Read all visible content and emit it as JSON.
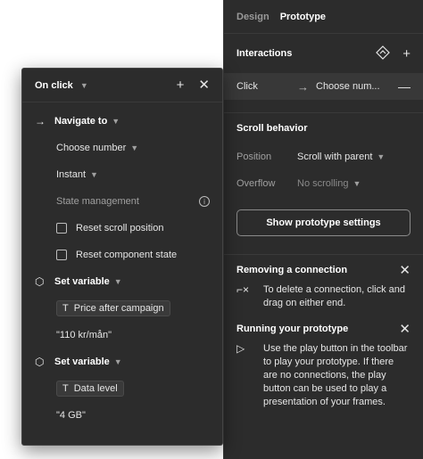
{
  "right_panel": {
    "tabs": [
      "Design",
      "Prototype"
    ],
    "interactions": {
      "title": "Interactions",
      "row": {
        "trigger": "Click",
        "destination": "Choose num..."
      }
    },
    "scroll_behavior": {
      "title": "Scroll behavior",
      "position_label": "Position",
      "position_value": "Scroll with parent",
      "overflow_label": "Overflow",
      "overflow_value": "No scrolling"
    },
    "settings_button": "Show prototype settings",
    "help": [
      {
        "title": "Removing a connection",
        "text": "To delete a connection, click and drag on either end."
      },
      {
        "title": "Running your prototype",
        "text": "Use the play button in the toolbar to play your prototype. If there are no connections, the play button can be used to play a presentation of your frames."
      }
    ]
  },
  "popover": {
    "title": "On click",
    "navigate_label": "Navigate to",
    "destination": "Choose number",
    "animation": "Instant",
    "state_management": "State management",
    "reset_scroll": "Reset scroll position",
    "reset_component": "Reset component state",
    "set_variable_1": "Set variable",
    "variable_1": "Price after campaign",
    "value_1": "\"110 kr/mån\"",
    "set_variable_2": "Set variable",
    "variable_2": "Data level",
    "value_2": "\"4 GB\""
  }
}
